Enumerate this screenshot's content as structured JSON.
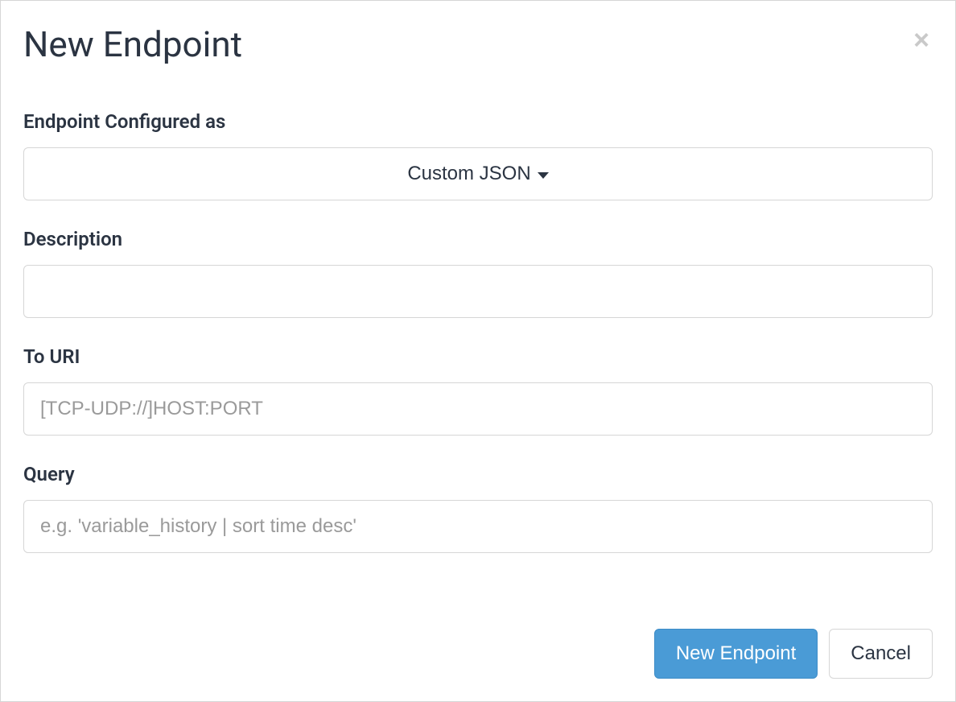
{
  "modal": {
    "title": "New Endpoint",
    "close_label": "×"
  },
  "form": {
    "configured_as": {
      "label": "Endpoint Configured as",
      "selected": "Custom JSON"
    },
    "description": {
      "label": "Description",
      "value": "",
      "placeholder": ""
    },
    "to_uri": {
      "label": "To URI",
      "value": "",
      "placeholder": "[TCP-UDP://]HOST:PORT"
    },
    "query": {
      "label": "Query",
      "value": "",
      "placeholder": "e.g. 'variable_history | sort time desc'"
    }
  },
  "footer": {
    "submit_label": "New Endpoint",
    "cancel_label": "Cancel"
  }
}
